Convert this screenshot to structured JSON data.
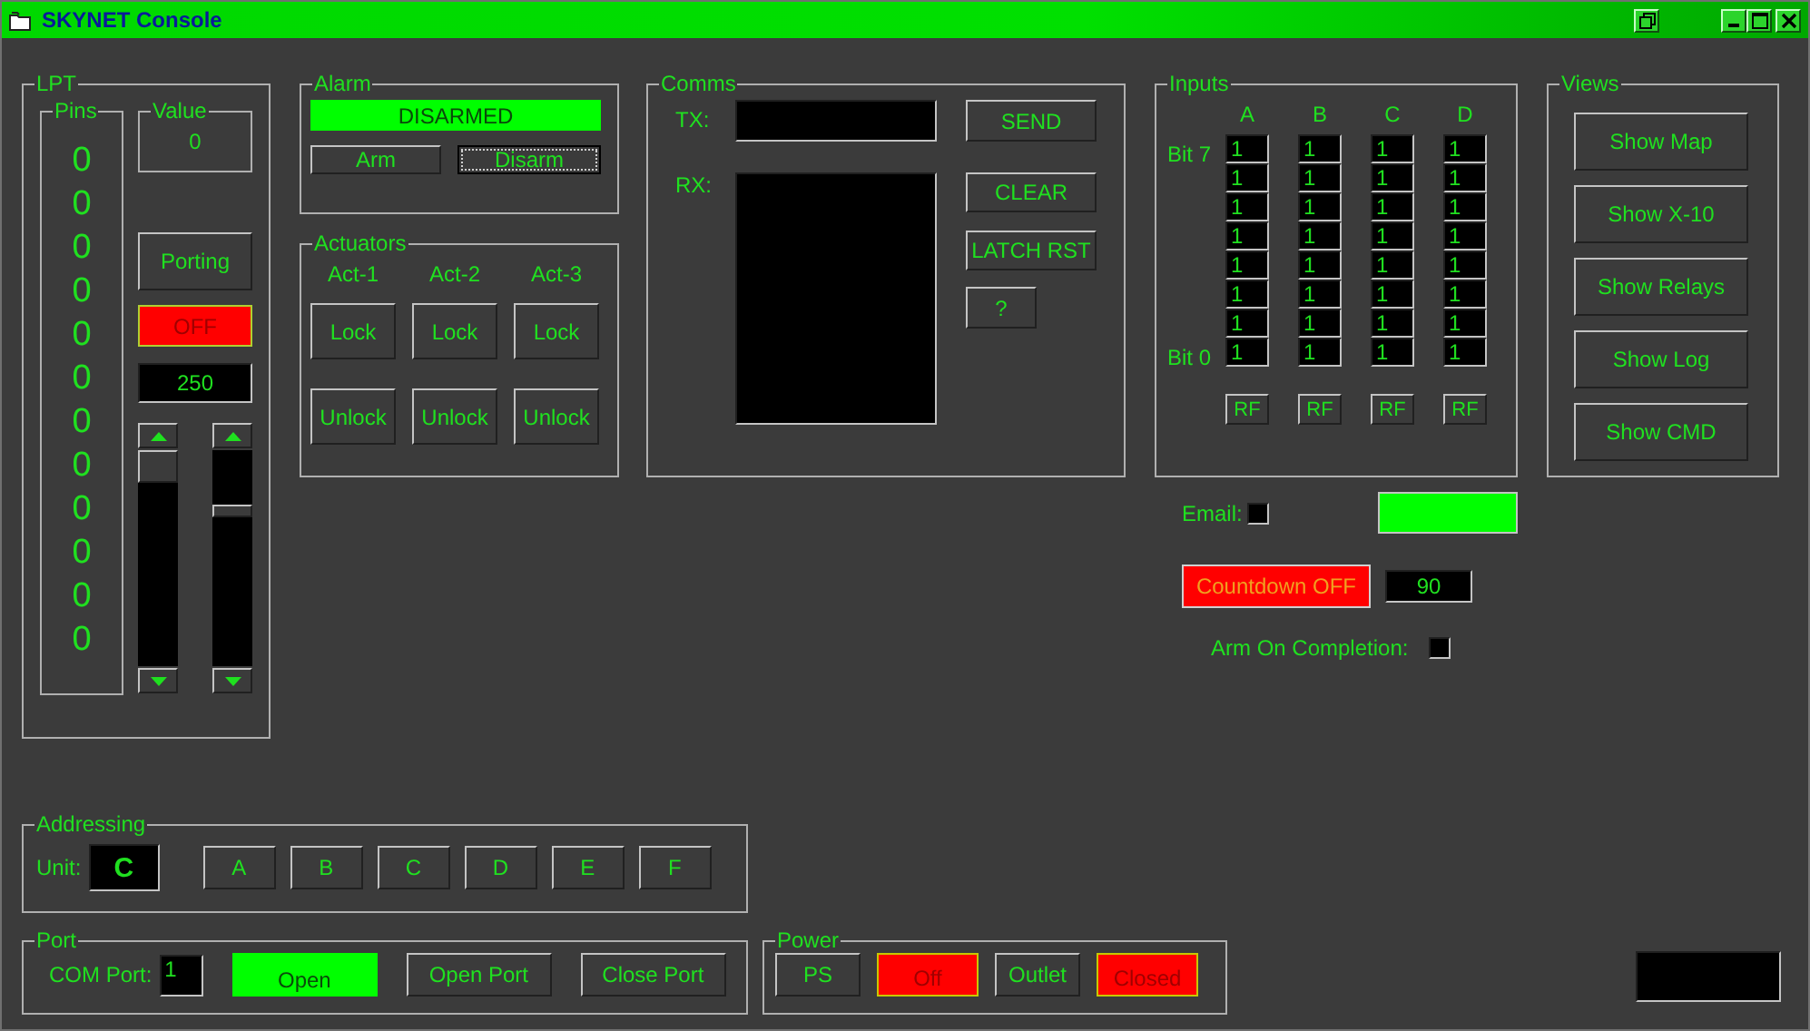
{
  "window": {
    "title": "SKYNET Console"
  },
  "lpt": {
    "title": "LPT",
    "pins": {
      "title": "Pins",
      "values": [
        "0",
        "0",
        "0",
        "0",
        "0",
        "0",
        "0",
        "0",
        "0",
        "0",
        "0",
        "0"
      ]
    },
    "value": {
      "title": "Value",
      "text": "0"
    },
    "porting_button": "Porting",
    "status": {
      "text": "OFF",
      "on": false
    },
    "rate": "250"
  },
  "alarm": {
    "title": "Alarm",
    "status": {
      "text": "DISARMED",
      "on": true
    },
    "buttons": [
      {
        "label": "Arm",
        "focused": false
      },
      {
        "label": "Disarm",
        "focused": true
      }
    ]
  },
  "actuators": {
    "title": "Actuators",
    "items": [
      {
        "label": "Act-1",
        "lock": "Lock",
        "unlock": "Unlock"
      },
      {
        "label": "Act-2",
        "lock": "Lock",
        "unlock": "Unlock"
      },
      {
        "label": "Act-3",
        "lock": "Lock",
        "unlock": "Unlock"
      }
    ]
  },
  "comms": {
    "title": "Comms",
    "tx_label": "TX:",
    "rx_label": "RX:",
    "buttons": [
      "SEND",
      "CLEAR",
      "LATCH RST",
      "?"
    ]
  },
  "inputs": {
    "title": "Inputs",
    "top_label": "Bit 7",
    "bottom_label": "Bit 0",
    "columns": [
      {
        "label": "A",
        "bits": [
          "1",
          "1",
          "1",
          "1",
          "1",
          "1",
          "1",
          "1"
        ],
        "button": "RF"
      },
      {
        "label": "B",
        "bits": [
          "1",
          "1",
          "1",
          "1",
          "1",
          "1",
          "1",
          "1"
        ],
        "button": "RF"
      },
      {
        "label": "C",
        "bits": [
          "1",
          "1",
          "1",
          "1",
          "1",
          "1",
          "1",
          "1"
        ],
        "button": "RF"
      },
      {
        "label": "D",
        "bits": [
          "1",
          "1",
          "1",
          "1",
          "1",
          "1",
          "1",
          "1"
        ],
        "button": "RF"
      }
    ]
  },
  "email": {
    "label": "Email:",
    "checked": false,
    "indicator_on": true
  },
  "countdown": {
    "button": {
      "text": "Countdown OFF",
      "on": false
    },
    "value": "90",
    "arm_label": "Arm On Completion:",
    "arm_checked": false
  },
  "views": {
    "title": "Views",
    "buttons": [
      "Show Map",
      "Show X-10",
      "Show Relays",
      "Show Log",
      "Show CMD"
    ]
  },
  "addressing": {
    "title": "Addressing",
    "unit_label": "Unit:",
    "unit": "C",
    "buttons": [
      "A",
      "B",
      "C",
      "D",
      "E",
      "F"
    ]
  },
  "port": {
    "title": "Port",
    "label": "COM Port:",
    "value": "1",
    "status": {
      "text": "Open",
      "on": true
    },
    "buttons": [
      "Open Port",
      "Close Port"
    ]
  },
  "power": {
    "title": "Power",
    "items": [
      {
        "kind": "button",
        "label": "PS"
      },
      {
        "kind": "indicator",
        "label": "Off",
        "on": false
      },
      {
        "kind": "button",
        "label": "Outlet"
      },
      {
        "kind": "indicator",
        "label": "Closed",
        "on": false
      }
    ]
  }
}
